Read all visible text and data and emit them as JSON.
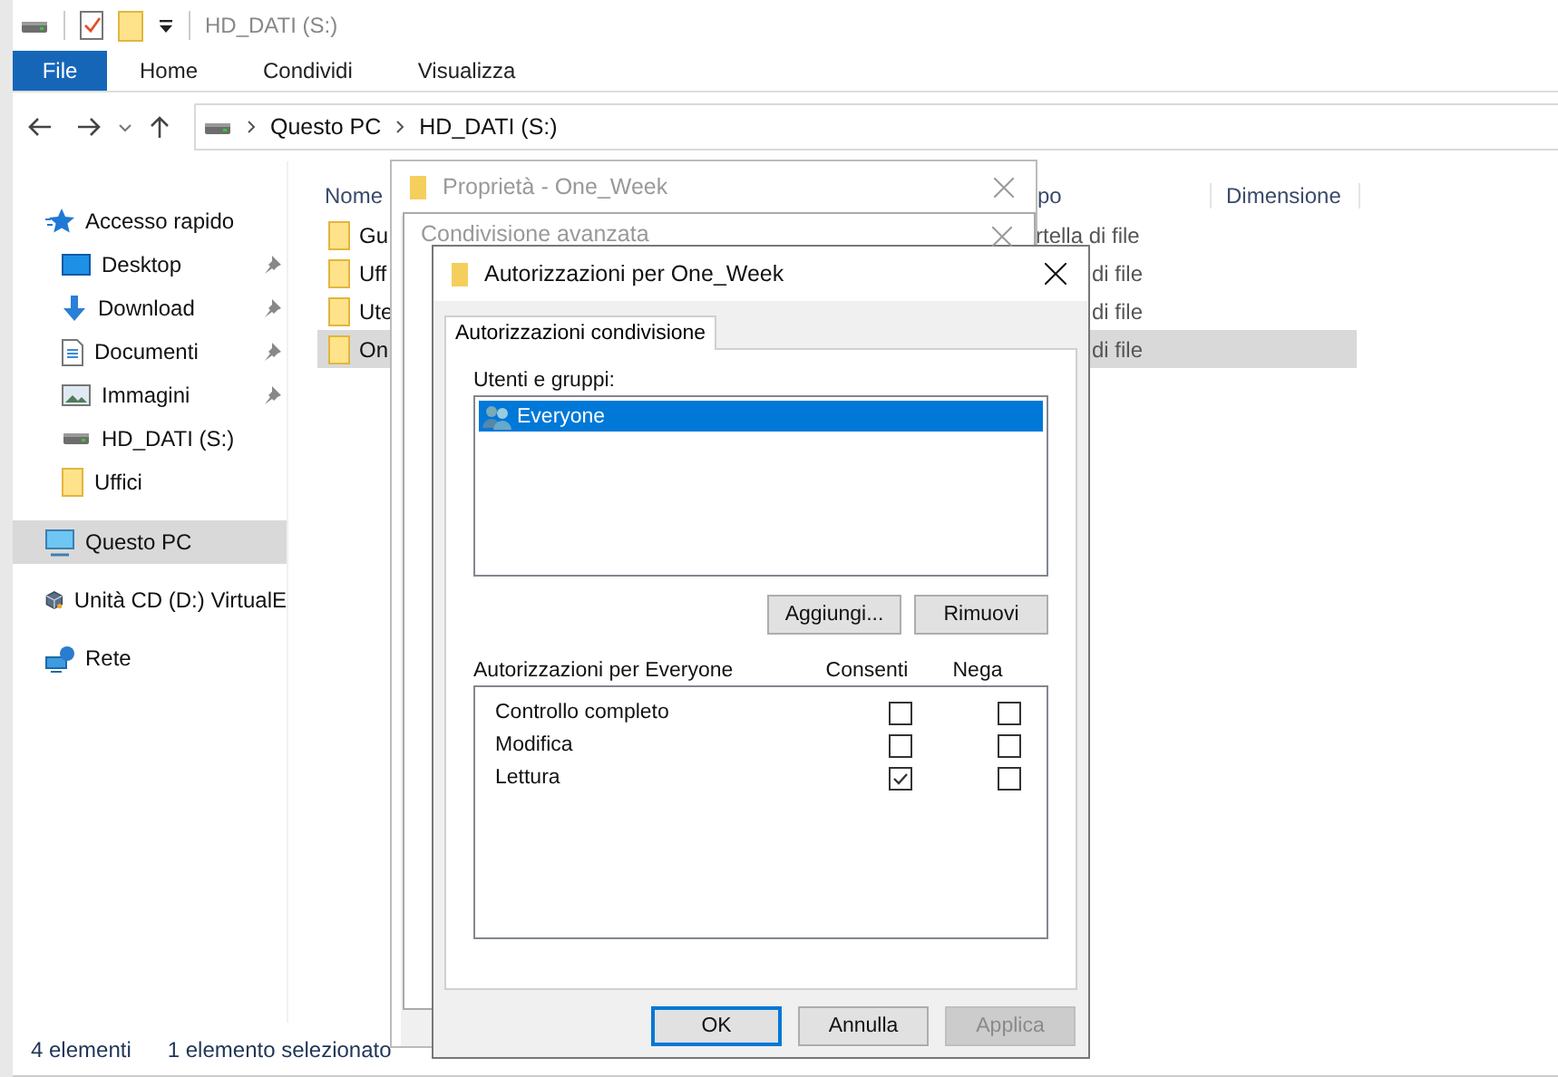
{
  "window": {
    "title": "HD_DATI (S:)"
  },
  "ribbon_tabs": [
    {
      "label": "File",
      "kind": "menu"
    },
    {
      "label": "Home",
      "kind": "tab"
    },
    {
      "label": "Condividi",
      "kind": "tab"
    },
    {
      "label": "Visualizza",
      "kind": "tab"
    }
  ],
  "address": {
    "path": [
      "Questo PC",
      "HD_DATI (S:)"
    ]
  },
  "nav": [
    {
      "label": "Accesso rapido",
      "kind": "star",
      "pinned": false,
      "selected": false,
      "group": true
    },
    {
      "label": "Desktop",
      "kind": "desktop",
      "pinned": true,
      "selected": false,
      "group": false
    },
    {
      "label": "Download",
      "kind": "download",
      "pinned": true,
      "selected": false,
      "group": false
    },
    {
      "label": "Documenti",
      "kind": "document",
      "pinned": true,
      "selected": false,
      "group": false
    },
    {
      "label": "Immagini",
      "kind": "pictures",
      "pinned": true,
      "selected": false,
      "group": false
    },
    {
      "label": "HD_DATI (S:)",
      "kind": "drive",
      "pinned": false,
      "selected": false,
      "group": false
    },
    {
      "label": "Uffici",
      "kind": "folder",
      "pinned": false,
      "selected": false,
      "group": false
    },
    {
      "label": "Questo PC",
      "kind": "pc",
      "pinned": false,
      "selected": true,
      "group": true
    },
    {
      "label": "Unità CD (D:) VirtualE",
      "kind": "cd",
      "pinned": false,
      "selected": false,
      "group": true
    },
    {
      "label": "Rete",
      "kind": "network",
      "pinned": false,
      "selected": false,
      "group": true
    }
  ],
  "file_list": {
    "columns": [
      "Nome",
      "po",
      "Dimensione"
    ],
    "rows": [
      {
        "name": "Gu",
        "type": "rtella di file",
        "selected": false
      },
      {
        "name": "Uff",
        "type": "di file",
        "selected": false
      },
      {
        "name": "Ute",
        "type": "di file",
        "selected": false
      },
      {
        "name": "On",
        "type": "di file",
        "selected": true
      }
    ]
  },
  "status_bar": [
    "4 elementi",
    "1 elemento selezionato"
  ],
  "properties_dialog": {
    "title": "Proprietà - One_Week"
  },
  "advanced_dialog": {
    "title": "Condivisione avanzata"
  },
  "permissions_dialog": {
    "title": "Autorizzazioni per One_Week",
    "tab": "Autorizzazioni condivisione",
    "users_label": "Utenti e gruppi:",
    "users": [
      {
        "name": "Everyone",
        "selected": true
      }
    ],
    "user_buttons": [
      "Aggiungi...",
      "Rimuovi"
    ],
    "perm_header": "Autorizzazioni per Everyone",
    "perm_columns": [
      "Consenti",
      "Nega"
    ],
    "permissions": [
      {
        "name": "Controllo completo",
        "allow": false,
        "deny": false
      },
      {
        "name": "Modifica",
        "allow": false,
        "deny": false
      },
      {
        "name": "Lettura",
        "allow": true,
        "deny": false
      }
    ],
    "footer_buttons": [
      {
        "label": "OK",
        "default": true,
        "disabled": false
      },
      {
        "label": "Annulla",
        "default": false,
        "disabled": false
      },
      {
        "label": "Applica",
        "default": false,
        "disabled": true
      }
    ]
  }
}
